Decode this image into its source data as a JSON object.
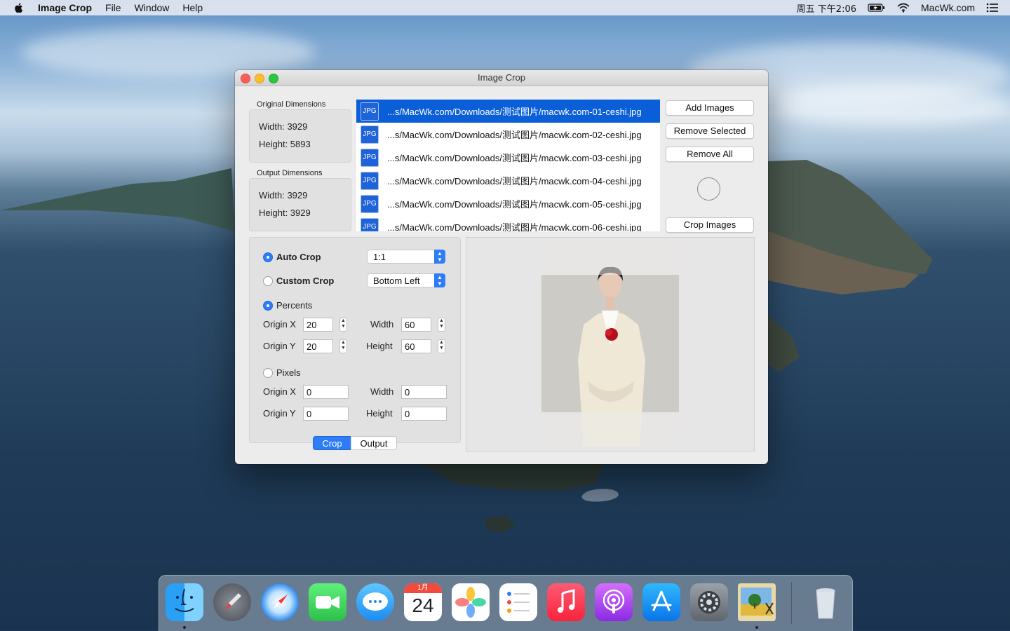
{
  "menubar": {
    "app_name": "Image Crop",
    "menus": [
      "File",
      "Window",
      "Help"
    ],
    "clock": "周五 下午2:06",
    "site": "MacWk.com"
  },
  "window": {
    "title": "Image Crop",
    "original": {
      "heading": "Original Dimensions",
      "width_text": "Width: 3929",
      "height_text": "Height: 5893"
    },
    "output": {
      "heading": "Output Dimensions",
      "width_text": "Width: 3929",
      "height_text": "Height: 3929"
    },
    "files": [
      {
        "badge": "JPG",
        "path": "...s/MacWk.com/Downloads/测试图片/macwk.com-01-ceshi.jpg",
        "selected": true
      },
      {
        "badge": "JPG",
        "path": "...s/MacWk.com/Downloads/测试图片/macwk.com-02-ceshi.jpg",
        "selected": false
      },
      {
        "badge": "JPG",
        "path": "...s/MacWk.com/Downloads/测试图片/macwk.com-03-ceshi.jpg",
        "selected": false
      },
      {
        "badge": "JPG",
        "path": "...s/MacWk.com/Downloads/测试图片/macwk.com-04-ceshi.jpg",
        "selected": false
      },
      {
        "badge": "JPG",
        "path": "...s/MacWk.com/Downloads/测试图片/macwk.com-05-ceshi.jpg",
        "selected": false
      },
      {
        "badge": "JPG",
        "path": "...s/MacWk.com/Downloads/测试图片/macwk.com-06-ceshi.jpg",
        "selected": false
      }
    ],
    "buttons": {
      "add": "Add Images",
      "remove_selected": "Remove Selected",
      "remove_all": "Remove All",
      "crop": "Crop Images"
    },
    "crop": {
      "auto_label": "Auto Crop",
      "auto_selected": true,
      "ratio": "1:1",
      "custom_label": "Custom Crop",
      "custom_selected": false,
      "anchor": "Bottom Left",
      "percents_label": "Percents",
      "percents_selected": true,
      "pct_origin_x_label": "Origin X",
      "pct_origin_x": "20",
      "pct_origin_y_label": "Origin Y",
      "pct_origin_y": "20",
      "pct_width_label": "Width",
      "pct_width": "60",
      "pct_height_label": "Height",
      "pct_height": "60",
      "pixels_label": "Pixels",
      "pixels_selected": false,
      "px_origin_x_label": "Origin X",
      "px_origin_x": "0",
      "px_origin_y_label": "Origin Y",
      "px_origin_y": "0",
      "px_width_label": "Width",
      "px_width": "0",
      "px_height_label": "Height",
      "px_height": "0"
    },
    "tabs": {
      "crop": "Crop",
      "output": "Output",
      "active": "Crop"
    }
  },
  "dock": {
    "apps": [
      "Finder",
      "Launchpad",
      "Safari",
      "FaceTime",
      "Messages",
      "Calendar",
      "Photos",
      "Reminders",
      "Music",
      "Podcasts",
      "App Store",
      "System Preferences",
      "Image Crop",
      "Trash"
    ],
    "calendar_month": "1月",
    "calendar_day": "24"
  }
}
